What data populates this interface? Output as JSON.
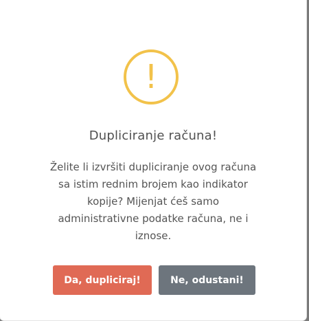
{
  "dialog": {
    "icon": "warning-icon",
    "icon_glyph": "!",
    "icon_color": "#f2c24a",
    "title": "Dupliciranje računa!",
    "message": "Želite li izvršiti dupliciranje ovog računa sa istim rednim brojem kao indikator kopije? Mijenjat ćeš samo administrativne podatke računa, ne i iznose.",
    "confirm_label": "Da, dupliciraj!",
    "cancel_label": "Ne, odustani!",
    "confirm_color": "#e06a55",
    "cancel_color": "#6d757d"
  }
}
